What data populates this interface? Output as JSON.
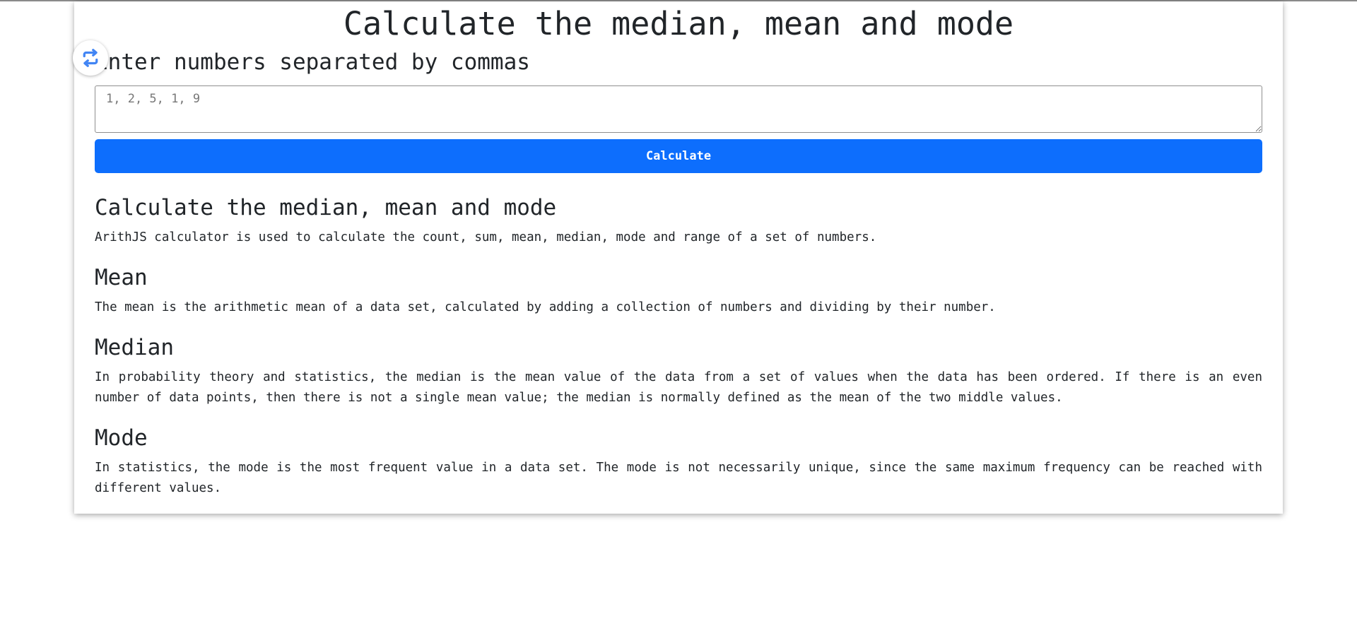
{
  "page": {
    "title": "Calculate the median, mean and mode"
  },
  "form": {
    "label": "Enter numbers separated by commas",
    "placeholder": "1, 2, 5, 1, 9",
    "button_label": "Calculate"
  },
  "overlay": {
    "icon": "swap-arrows-icon",
    "color": "#4285f4"
  },
  "content": {
    "heading": "Calculate the median, mean and mode",
    "intro": "ArithJS calculator is used to calculate the count, sum, mean, median, mode and range of a set of numbers.",
    "sections": [
      {
        "heading": "Mean",
        "text": "The mean is the arithmetic mean of a data set, calculated by adding a collection of numbers and dividing by their number."
      },
      {
        "heading": "Median",
        "text": "In probability theory and statistics, the median is the mean value of the data from a set of values when the data has been ordered. If there is an even number of data points, then there is not a single mean value; the median is normally defined as the mean of the two middle values."
      },
      {
        "heading": "Mode",
        "text": "In statistics, the mode is the most frequent value in a data set. The mode is not necessarily unique, since the same maximum frequency can be reached with different values."
      }
    ]
  },
  "colors": {
    "accent": "#0d6efd",
    "text": "#212529"
  }
}
